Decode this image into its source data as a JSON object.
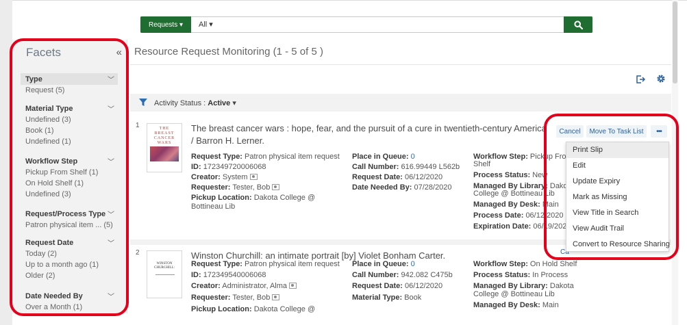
{
  "search": {
    "type_label": "Requests ▾",
    "scope_label": "All ▾",
    "placeholder": "",
    "search_icon": "search-icon"
  },
  "page": {
    "title": "Resource Request Monitoring (1 - 5 of 5 )"
  },
  "facets": {
    "title": "Facets",
    "collapse_glyph": "«",
    "groups": [
      {
        "label": "Type",
        "items": [
          "Request (5)"
        ]
      },
      {
        "label": "Material Type",
        "items": [
          "Undefined (3)",
          "Book (1)",
          "Undefined (1)"
        ]
      },
      {
        "label": "Workflow Step",
        "items": [
          "Pickup From Shelf (1)",
          "On Hold Shelf (1)",
          "Undefined (3)"
        ]
      },
      {
        "label": "Request/Process Type",
        "items": [
          "Patron physical item ... (5)"
        ]
      },
      {
        "label": "Request Date",
        "items": [
          "Today (2)",
          "Up to a month ago (1)",
          "Older (2)"
        ]
      },
      {
        "label": "Date Needed By",
        "items": [
          "Over a Month (1)"
        ]
      }
    ]
  },
  "filter": {
    "label": "Activity Status :",
    "value": "Active",
    "caret": "▾"
  },
  "toolbar_icons": [
    "export-icon",
    "gear-icon"
  ],
  "results": [
    {
      "num": "1",
      "title": "The breast cancer wars : hope, fear, and the pursuit of a cure in twentieth-century America / Barron H. Lerner.",
      "request_type_label": "Request Type:",
      "request_type": "Patron physical item request",
      "id_label": "ID:",
      "id": "172349720006068",
      "creator_label": "Creator:",
      "creator": "System",
      "requester_label": "Requester:",
      "requester": "Tester, Bob",
      "pickup_label": "Pickup Location:",
      "pickup_line1": "Dakota College @",
      "pickup_line2": "Bottineau Lib",
      "queue_label": "Place in Queue:",
      "queue": "0",
      "call_label": "Call Number:",
      "call": "616.99449 L562b",
      "req_date_label": "Request Date:",
      "req_date": "06/12/2020",
      "needed_label": "Date Needed By:",
      "needed": "07/28/2020",
      "workflow_label": "Workflow Step:",
      "workflow_line1": "Pickup From",
      "workflow_line2": "Shelf",
      "proc_status_label": "Process Status:",
      "proc_status": "New",
      "managed_lib_label": "Managed By Library:",
      "managed_lib_line1": "Dakota",
      "managed_lib_line2": "College @ Bottineau Lib",
      "managed_desk_label": "Managed By Desk:",
      "managed_desk": "Main",
      "proc_date_label": "Process Date:",
      "proc_date": "06/12/2020",
      "exp_date_label": "Expiration Date:",
      "exp_date": "06/19/2020",
      "thumb_text": [
        "THE",
        "BREAST",
        "CANCER",
        "WARS"
      ]
    },
    {
      "num": "2",
      "title": "Winston Churchill: an intimate portrait [by] Violet Bonham Carter.",
      "request_type_label": "Request Type:",
      "request_type": "Patron physical item request",
      "id_label": "ID:",
      "id": "172349540006068",
      "creator_label": "Creator:",
      "creator": "Administrator, Alma",
      "requester_label": "Requester:",
      "requester": "Tester, Bob",
      "pickup_label": "Pickup Location:",
      "pickup_line1": "Dakota College @",
      "queue_label": "Place in Queue:",
      "queue": "0",
      "call_label": "Call Number:",
      "call": "942.082 C475b",
      "req_date_label": "Request Date:",
      "req_date": "06/12/2020",
      "material_label": "Material Type:",
      "material": "Book",
      "workflow_label": "Workflow Step:",
      "workflow_line1": "On Hold Shelf",
      "proc_status_label": "Process Status:",
      "proc_status": "In Process",
      "managed_lib_label": "Managed By Library:",
      "managed_lib_line1": "Dakota",
      "managed_lib_line2": "College @ Bottineau Lib",
      "managed_desk_label": "Managed By Desk:",
      "managed_desk": "Main",
      "thumb_text": [
        "WINSTON",
        "CHURCHILL:"
      ],
      "partial_cancel": "Ca"
    }
  ],
  "actions": {
    "cancel": "Cancel",
    "move_to_task_list": "Move To Task List",
    "more": "•••"
  },
  "menu": {
    "items": [
      "Print Slip",
      "Edit",
      "Update Expiry",
      "Mark as Missing",
      "View Title in Search",
      "View Audit Trail",
      "Convert to Resource Sharing"
    ]
  },
  "colors": {
    "brand_green": "#1f6d31",
    "highlight_red": "#e4001b",
    "link_blue": "#2a6db5"
  }
}
